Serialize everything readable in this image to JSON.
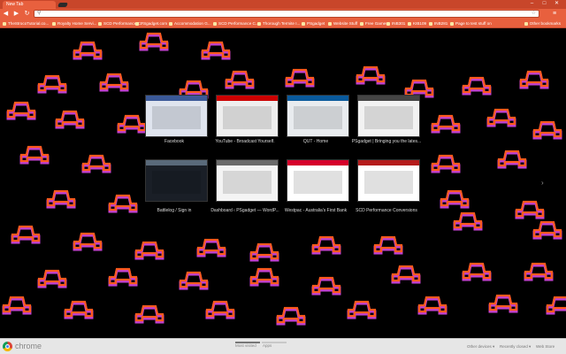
{
  "window": {
    "tab_title": "New Tab",
    "controls": [
      "–",
      "□",
      "✕"
    ]
  },
  "toolbar": {
    "back": "◀",
    "forward": "▶",
    "reload": "↻",
    "omnibox_value": "",
    "wrench": "🔧"
  },
  "bookmarks": [
    "TheStrocoTutorial.co...",
    "Royalty Home Servi...",
    "SCD Performance C...",
    "PSgadget.com",
    "Accommodation G...",
    "SCD Performance C...",
    "Thorough Termite I...",
    "PSgadget",
    "Website Stuff",
    "Free Games",
    "INB301",
    "KIB109",
    "INB281",
    "Page to test stuff on",
    "Other bookmarks"
  ],
  "thumbnails": [
    {
      "label": "Facebook",
      "tone": "#dfe4ee",
      "accent": "#3b5998"
    },
    {
      "label": "YouTube - Broadcast Yourself.",
      "tone": "#eeeeee",
      "accent": "#cc0000"
    },
    {
      "label": "QUT - Home",
      "tone": "#e9ecef",
      "accent": "#0a5a9c"
    },
    {
      "label": "PSgadget | Bringing you the lates...",
      "tone": "#f2f2f2",
      "accent": "#444444"
    },
    {
      "label": "Battlelog / Sign in",
      "tone": "#1a1f27",
      "accent": "#5a6a7a"
    },
    {
      "label": "Dashboard ‹ PSgadget — WordP...",
      "tone": "#f4f4f4",
      "accent": "#6a6a6a"
    },
    {
      "label": "Westpac - Australia's First Bank",
      "tone": "#ffffff",
      "accent": "#d5002b"
    },
    {
      "label": "SCD Performance Conversions",
      "tone": "#ffffff",
      "accent": "#b41c1c"
    }
  ],
  "next_arrow": "›",
  "footer": {
    "brand": "chrome",
    "pages": [
      "Most visited",
      "Apps"
    ],
    "other_devices": "Other devices ▾",
    "recently_closed": "Recently closed ▾",
    "web_store": "Web Store"
  },
  "colors": {
    "frame": "#e8603e",
    "motif_orange": "#ff5a1e",
    "motif_purple": "#c040d0"
  }
}
